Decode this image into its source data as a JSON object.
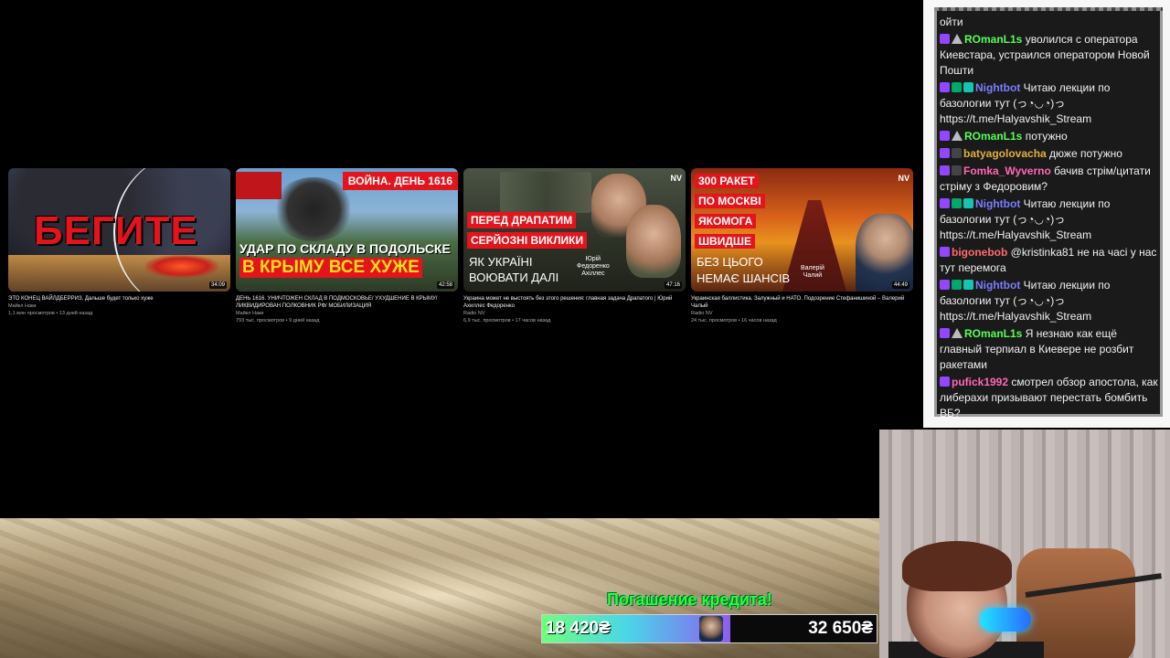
{
  "videos": [
    {
      "thumb_text": "БЕГИТЕ",
      "duration": "34:09",
      "title": "ЭТО КОНЕЦ ВАЙЛДБЕРРИЗ. Дальше будет только хуже",
      "channel": "Майкл Наки",
      "meta": "1,1 млн просмотров • 13 дней назад"
    },
    {
      "thumb_tag": "ВОЙНА. ДЕНЬ 1616",
      "thumb_line1": "УДАР ПО СКЛАДУ В ПОДОЛЬСКЕ",
      "thumb_line2": "В КРЫМУ ВСЕ ХУЖЕ",
      "duration": "42:58",
      "title": "ДЕНЬ 1616. УНИЧТОЖЕН СКЛАД В ПОДМОСКОВЬЕ/ УХУДШЕНИЕ В КРЫМУ/ ЛИКВИДИРОВАН ПОЛКОВНИК РФ/ МОБИЛИЗАЦИЯ",
      "channel": "Майкл Наки",
      "meta": "793 тыс. просмотров • 9 дней назад"
    },
    {
      "thumb_h1": "ПЕРЕД ДРАПАТИМ",
      "thumb_h2": "СЕРЙОЗНІ ВИКЛИКИ",
      "thumb_s1": "ЯК УКРАЇНІ",
      "thumb_s2": "ВОЮВАТИ ДАЛІ",
      "thumb_caption": "Юрій\nФедоренко\nАхіллес",
      "logo": "NV",
      "duration": "47:16",
      "title": "Украина может не выстоять без этого решения: главная задача Драпатого | Юрий Ахиллес Федоренко",
      "channel": "Radio NV",
      "meta": "6,9 тыс. просмотров • 17 часов назад"
    },
    {
      "thumb_r1": "300 РАКЕТ",
      "thumb_r2": "ПО МОСКВІ",
      "thumb_r3": "ЯКОМОГА",
      "thumb_r4": "ШВИДШЕ",
      "thumb_w1": "БЕЗ ЦЬОГО",
      "thumb_w2": "НЕМАЄ ШАНСІВ",
      "thumb_caption": "Валерій\nЧалий",
      "logo": "NV",
      "duration": "44:49",
      "title": "Украинская баллистика. Залужный и НАТО. Подозрение Стефанишиной – Валерий Чалый",
      "channel": "Radio NV",
      "meta": "24 тыс. просмотров • 16 часов назад"
    }
  ],
  "chat": {
    "messages": [
      {
        "user": "",
        "color": "#ffffff",
        "badges": [],
        "text": "ойти"
      },
      {
        "user": "ROmanL1s",
        "color": "#57ff57",
        "badges": [
          "twitch",
          "tri"
        ],
        "text": "уволился с оператора Киевстара, устраился оператором Новой Пошти"
      },
      {
        "user": "Nightbot",
        "color": "#7c7cff",
        "badges": [
          "twitch",
          "green",
          "teal"
        ],
        "text": "Читаю лекции по базологии тут (っ◔◡◔)っ https://t.me/Halyavshik_Stream"
      },
      {
        "user": "ROmanL1s",
        "color": "#57ff57",
        "badges": [
          "twitch",
          "tri"
        ],
        "text": "потужно"
      },
      {
        "user": "batyagolovacha",
        "color": "#e0b040",
        "badges": [
          "twitch",
          "mic"
        ],
        "text": "дюже потужно"
      },
      {
        "user": "Fomka_Wyverno",
        "color": "#ff69b4",
        "badges": [
          "twitch",
          "mic"
        ],
        "text": "бачив стрім/цитати стріму з Федоровим?"
      },
      {
        "user": "Nightbot",
        "color": "#7c7cff",
        "badges": [
          "twitch",
          "green",
          "teal"
        ],
        "text": "Читаю лекции по базологии тут (っ◔◡◔)っ https://t.me/Halyavshik_Stream"
      },
      {
        "user": "bigonebob",
        "color": "#ff6b6b",
        "badges": [
          "twitch"
        ],
        "text": "@kristinka81 не на часі у нас тут перемога"
      },
      {
        "user": "Nightbot",
        "color": "#7c7cff",
        "badges": [
          "twitch",
          "green",
          "teal"
        ],
        "text": "Читаю лекции по базологии тут (っ◔◡◔)っ https://t.me/Halyavshik_Stream"
      },
      {
        "user": "ROmanL1s",
        "color": "#57ff57",
        "badges": [
          "twitch",
          "tri"
        ],
        "text": "Я незнаю как ещё главный терпиал в Киевере не розбит ракетами"
      },
      {
        "user": "pufick1992",
        "color": "#ff69b4",
        "badges": [
          "twitch"
        ],
        "text": "смотрел обзор апостола, как либерахи призывают перестать бомбить ВБ?"
      }
    ]
  },
  "credit": {
    "title": "Погашение кредита!",
    "current": "18 420₴",
    "goal": "32 650₴",
    "progress": 0.564
  }
}
